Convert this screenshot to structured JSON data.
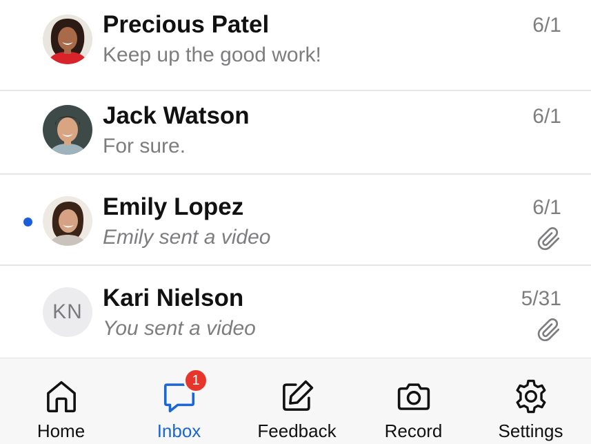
{
  "conversations": [
    {
      "name": "Precious Patel",
      "preview": "Keep up the good work!",
      "date": "6/1",
      "unread": false,
      "attachment": false,
      "avatar": "photo"
    },
    {
      "name": "Jack Watson",
      "preview": "For sure.",
      "date": "6/1",
      "unread": false,
      "attachment": false,
      "avatar": "photo"
    },
    {
      "name": "Emily Lopez",
      "preview": "Emily sent a video",
      "date": "6/1",
      "unread": true,
      "attachment": true,
      "avatar": "photo"
    },
    {
      "name": "Kari Nielson",
      "initials": "KN",
      "preview": "You sent a video",
      "date": "5/31",
      "unread": false,
      "attachment": true,
      "avatar": "initials"
    }
  ],
  "tabbar": {
    "home": "Home",
    "inbox": "Inbox",
    "inbox_badge": "1",
    "feedback": "Feedback",
    "record": "Record",
    "settings": "Settings"
  },
  "colors": {
    "accent": "#1a66d6",
    "unread_dot": "#1a5fd9",
    "badge": "#e8352c",
    "muted_text": "#7d7d80"
  },
  "icons": [
    "home-icon",
    "chat-bubble-icon",
    "edit-icon",
    "camera-icon",
    "gear-icon",
    "paperclip-icon"
  ]
}
